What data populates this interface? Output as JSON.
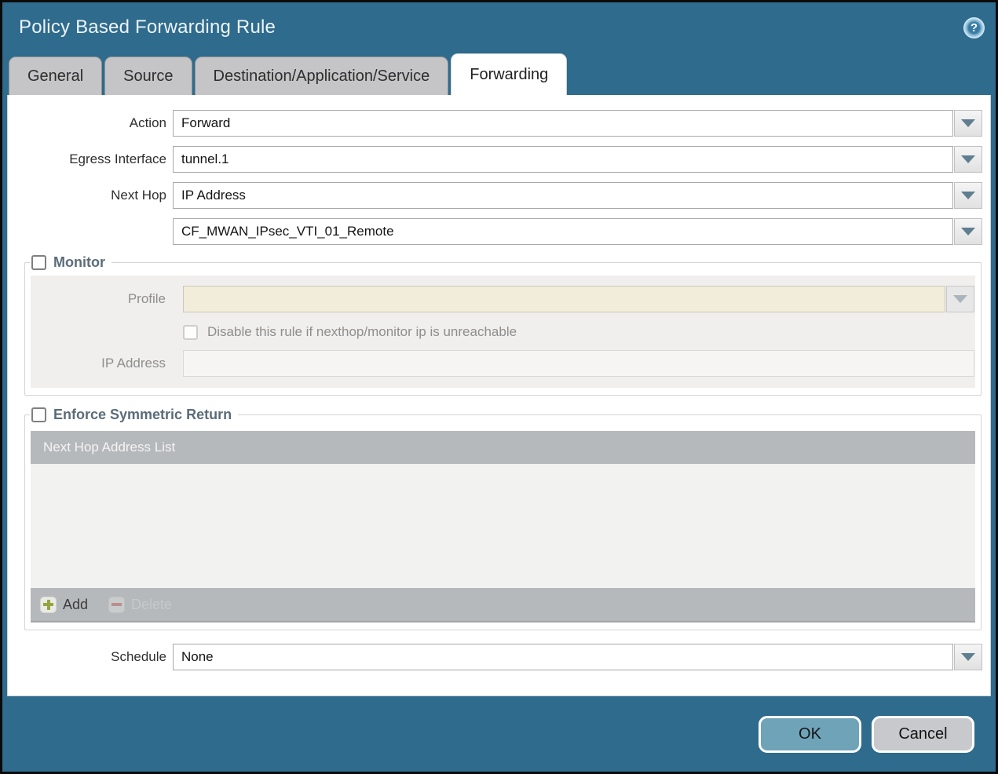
{
  "window": {
    "title": "Policy Based Forwarding Rule",
    "help_icon": "question-mark"
  },
  "tabs": [
    {
      "label": "General",
      "active": false
    },
    {
      "label": "Source",
      "active": false
    },
    {
      "label": "Destination/Application/Service",
      "active": false
    },
    {
      "label": "Forwarding",
      "active": true
    }
  ],
  "form": {
    "action": {
      "label": "Action",
      "value": "Forward"
    },
    "egress_interface": {
      "label": "Egress Interface",
      "value": "tunnel.1"
    },
    "next_hop": {
      "label": "Next Hop",
      "value": "IP Address"
    },
    "next_hop_address": {
      "value": "CF_MWAN_IPsec_VTI_01_Remote"
    },
    "schedule": {
      "label": "Schedule",
      "value": "None"
    }
  },
  "monitor": {
    "legend": "Monitor",
    "checked": false,
    "profile": {
      "label": "Profile",
      "value": ""
    },
    "disable_rule": {
      "label": "Disable this rule if nexthop/monitor ip is unreachable",
      "checked": false
    },
    "ip_address": {
      "label": "IP Address",
      "value": ""
    }
  },
  "symmetric_return": {
    "legend": "Enforce Symmetric Return",
    "checked": false,
    "table": {
      "header": "Next Hop Address List",
      "rows": []
    },
    "add_label": "Add",
    "delete_label": "Delete"
  },
  "footer": {
    "ok_label": "OK",
    "cancel_label": "Cancel"
  },
  "colors": {
    "titlebar_teal": "#2e6b8d",
    "ok_button": "#6fa3b8",
    "cancel_button": "#c7c9cc",
    "table_gray": "#b6b9bc",
    "disabled_beige": "#f2ecda"
  }
}
